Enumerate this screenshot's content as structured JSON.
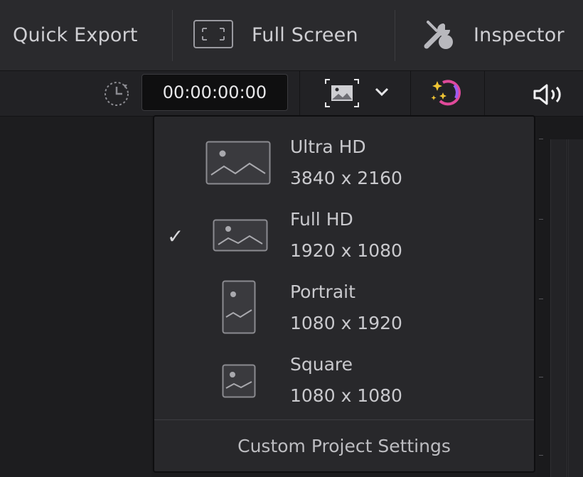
{
  "toolbar": {
    "quick_export": "Quick Export",
    "full_screen": "Full Screen",
    "inspector": "Inspector",
    "icons": [
      "fullscreen-icon",
      "inspector-tools-icon"
    ]
  },
  "viewer_bar": {
    "timecode": "00:00:00:00",
    "icons": [
      "timecode-clock-icon",
      "resolution-icon",
      "chevron-down-icon",
      "smart-color-icon",
      "speaker-icon"
    ]
  },
  "resolution_menu": {
    "items": [
      {
        "name": "Ultra HD",
        "resolution": "3840 x 2160",
        "selected": false,
        "icon": "landscape-large-icon"
      },
      {
        "name": "Full HD",
        "resolution": "1920 x 1080",
        "selected": true,
        "icon": "landscape-icon"
      },
      {
        "name": "Portrait",
        "resolution": "1080 x 1920",
        "selected": false,
        "icon": "portrait-icon"
      },
      {
        "name": "Square",
        "resolution": "1080 x 1080",
        "selected": false,
        "icon": "square-icon"
      }
    ],
    "check_mark": "✓",
    "custom_settings": "Custom Project Settings"
  },
  "colors": {
    "menu_bg": "#28282b",
    "toolbar_bg": "#2a2a2d",
    "timecode_bg": "#0f0f10",
    "text": "#c9c9cd"
  }
}
